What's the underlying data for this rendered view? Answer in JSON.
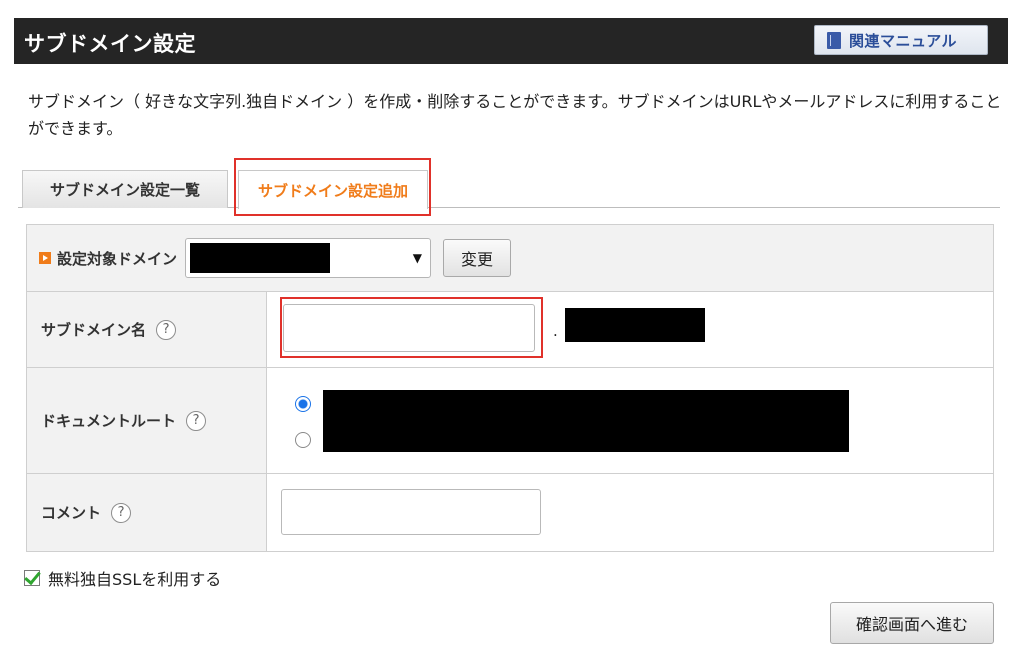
{
  "header": {
    "title": "サブドメイン設定",
    "manual_label": "関連マニュアル"
  },
  "description": "サブドメイン（ 好きな文字列.独自ドメイン ）を作成・削除することができます。サブドメインはURLやメールアドレスに利用することができます。",
  "tabs": [
    {
      "label": "サブドメイン設定一覧",
      "active": false
    },
    {
      "label": "サブドメイン設定追加",
      "active": true
    }
  ],
  "colors": {
    "active_tab": "#f07c1a",
    "highlight": "#e0312a",
    "header_bg": "#252525"
  },
  "form": {
    "domain_label": "設定対象ドメイン",
    "change_label": "変更",
    "subdomain_label": "サブドメイン名",
    "subdomain_value": "",
    "subdomain_separator": ".",
    "docroot_label": "ドキュメントルート",
    "comment_label": "コメント",
    "comment_value": "",
    "help_glyph": "?"
  },
  "ssl": {
    "label": "無料独自SSLを利用する",
    "checked": true
  },
  "confirm_label": "確認画面へ進む"
}
